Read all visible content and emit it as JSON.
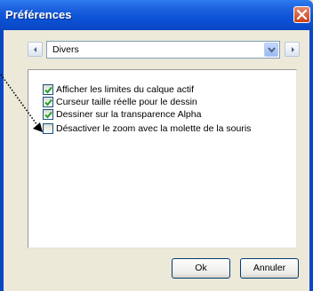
{
  "window": {
    "title": "Préférences"
  },
  "nav": {
    "prev_icon": "chevron-left-icon",
    "next_icon": "chevron-right-icon"
  },
  "category": {
    "selected": "Divers"
  },
  "options": [
    {
      "label": "Afficher les limites du calque actif",
      "checked": true
    },
    {
      "label": "Curseur taille réelle pour le dessin",
      "checked": true
    },
    {
      "label": "Dessiner sur la transparence Alpha",
      "checked": true
    },
    {
      "label": "Désactiver le zoom avec la molette de la souris",
      "checked": false
    }
  ],
  "buttons": {
    "ok": "Ok",
    "cancel": "Annuler"
  },
  "colors": {
    "titlebar": "#0a47c4",
    "accent_check": "#21a121",
    "close": "#c8411c"
  }
}
